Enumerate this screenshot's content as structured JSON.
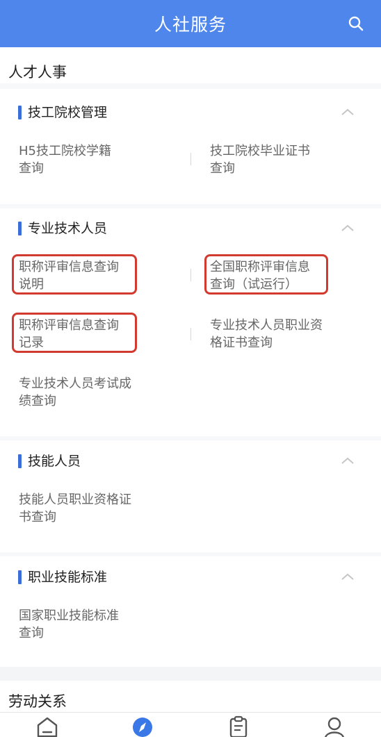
{
  "header": {
    "title": "人社服务"
  },
  "sections": [
    {
      "title": "人才人事",
      "categories": [
        {
          "title": "技工院校管理",
          "items": [
            "H5技工院校学籍\n查询",
            "技工院校毕业证书\n查询"
          ]
        },
        {
          "title": "专业技术人员",
          "items": [
            "职称评审信息查询\n说明",
            "全国职称评审信息\n查询（试运行）",
            "职称评审信息查询\n记录",
            "专业技术人员职业资\n格证书查询",
            "专业技术人员考试成\n绩查询"
          ]
        },
        {
          "title": "技能人员",
          "items": [
            "技能人员职业资格证\n书查询"
          ]
        },
        {
          "title": "职业技能标准",
          "items": [
            "国家职业技能标准\n查询"
          ]
        }
      ]
    },
    {
      "title": "劳动关系"
    }
  ],
  "colors": {
    "header": "#4f86ec",
    "accent_bar": "#3b6fd8",
    "highlight": "#d23a30"
  },
  "icons": {
    "search": "search-icon",
    "nav": [
      "home-icon",
      "compass-icon",
      "clipboard-icon",
      "user-icon"
    ]
  }
}
